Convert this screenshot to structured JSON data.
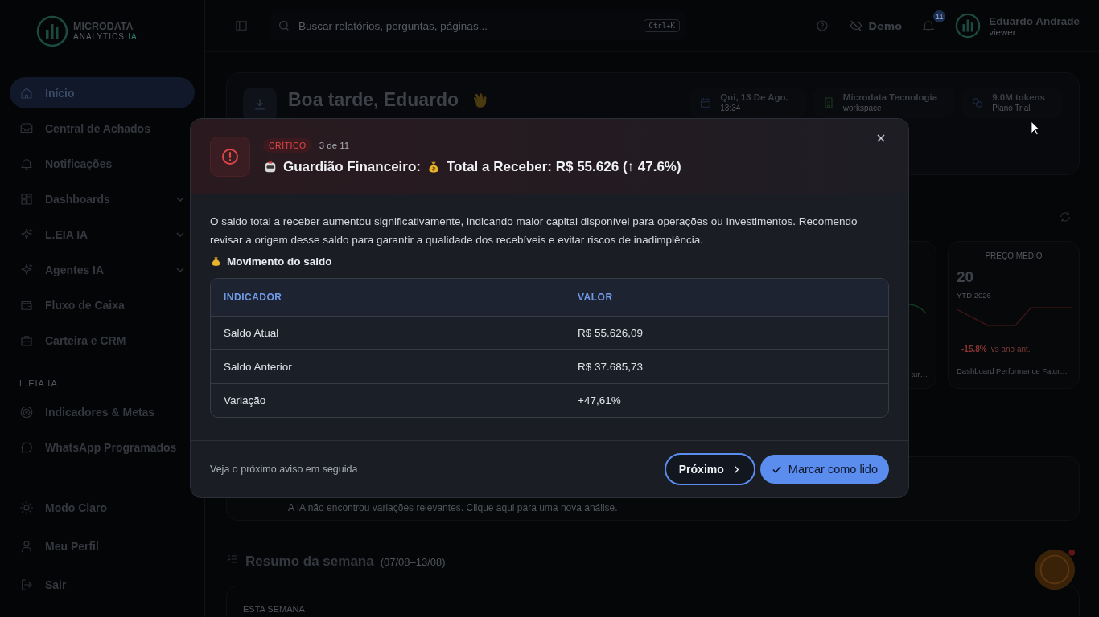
{
  "sidebar": {
    "logo": {
      "name": "MICRODATA",
      "sub": "ANALYTICS",
      "suffix": "·IA"
    },
    "items": [
      {
        "label": "Início",
        "selected": true,
        "expandable": false
      },
      {
        "label": "Central de Achados",
        "selected": false,
        "expandable": false
      },
      {
        "label": "Notificações",
        "selected": false,
        "expandable": false
      },
      {
        "label": "Dashboards",
        "selected": false,
        "expandable": true
      },
      {
        "label": "L.EIA IA",
        "selected": false,
        "expandable": true
      },
      {
        "label": "Agentes IA",
        "selected": false,
        "expandable": true
      },
      {
        "label": "Fluxo de Caixa",
        "selected": false,
        "expandable": false
      },
      {
        "label": "Carteira e CRM",
        "selected": false,
        "expandable": false
      }
    ],
    "section_label": "L.EIA IA",
    "section_items": [
      {
        "label": "Indicadores & Metas",
        "selected": false,
        "expandable": false
      },
      {
        "label": "WhatsApp Programados",
        "selected": false,
        "expandable": false
      }
    ],
    "bottom_items": [
      {
        "label": "Modo Claro"
      },
      {
        "label": "Meu Perfil"
      },
      {
        "label": "Sair"
      }
    ]
  },
  "topbar": {
    "search_placeholder": "Buscar relatórios, perguntas, páginas...",
    "shortcut": "Ctrl+K",
    "demo": "Demo",
    "notifications": "11",
    "user_name": "Eduardo Andrade",
    "user_role": "viewer"
  },
  "hero": {
    "greeting": "Boa tarde, Eduardo",
    "chips": [
      {
        "title": "Qui, 13 De Ago.",
        "sub": "13:34"
      },
      {
        "title": "Microdata Tecnologia",
        "sub": "workspace"
      },
      {
        "title": "9.0M tokens",
        "sub": "Plano Trial"
      }
    ]
  },
  "cards": [
    {
      "label": "tur…"
    },
    {
      "title": "PREÇO MEDIO",
      "value": "20",
      "period": "YTD 2026",
      "change": "-15.8%",
      "change_note": "vs ano ant.",
      "source": "Dashboard Performance Fatur…"
    }
  ],
  "insight_text": "A IA não encontrou variações relevantes. Clique aqui para uma nova análise.",
  "week": {
    "title": "Resumo da semana",
    "range": "(07/08–13/08)",
    "card_label": "ESTA SEMANA"
  },
  "modal": {
    "severity": "CRÍTICO",
    "counter": "3 de 11",
    "agent": "Guardião Financeiro:",
    "title": "Total a Receber: R$ 55.626 (↑ 47.6%)",
    "message": "O saldo total a receber aumentou significativamente, indicando maior capital disponível para operações ou investimentos. Recomendo revisar a origem desse saldo para garantir a qualidade dos recebíveis e evitar riscos de inadimplência.",
    "section": "Movimento do saldo",
    "columns": [
      "INDICADOR",
      "VALOR"
    ],
    "rows": [
      [
        "Saldo Atual",
        "R$ 55.626,09"
      ],
      [
        "Saldo Anterior",
        "R$ 37.685,73"
      ],
      [
        "Variação",
        "+47,61%"
      ]
    ],
    "footer_note": "Veja o próximo aviso em seguida",
    "next": "Próximo",
    "mark_read": "Marcar como lido"
  }
}
